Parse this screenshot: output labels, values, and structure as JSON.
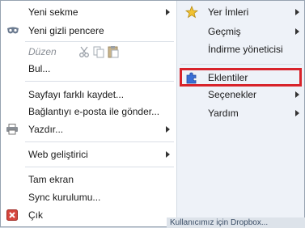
{
  "left_menu": {
    "new_tab": "Yeni sekme",
    "new_private_window": "Yeni gizli pencere",
    "edit": "Düzen",
    "find": "Bul...",
    "save_page_as": "Sayfayı farklı kaydet...",
    "email_link": "Bağlantıyı e-posta ile gönder...",
    "print": "Yazdır...",
    "web_developer": "Web geliştirici",
    "full_screen": "Tam ekran",
    "sync_setup": "Sync kurulumu...",
    "exit": "Çık"
  },
  "right_menu": {
    "bookmarks": "Yer İmleri",
    "history": "Geçmiş",
    "downloads": "İndirme yöneticisi",
    "addons": "Eklentiler",
    "options": "Seçenekler",
    "help": "Yardım"
  },
  "bottom_strip_text": "Kullanıcımız için Dropbox...",
  "colors": {
    "highlight_border": "#d8232a",
    "right_pane_bg": "#eef2f8",
    "left_pane_bg": "#ffffff"
  }
}
